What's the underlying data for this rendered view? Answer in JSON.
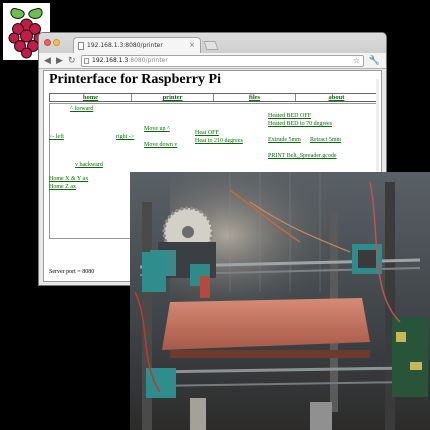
{
  "browser": {
    "tab_title": "192.168.1.3:8080/printer",
    "url_host": "192.168.1.3",
    "url_rest": ":8080/printer",
    "icons": [
      "back-arrow",
      "forward-arrow",
      "reload",
      "star",
      "wrench",
      "close"
    ]
  },
  "page": {
    "title": "Printerface for Raspberry Pi",
    "nav": [
      "home",
      "printer",
      "files",
      "about"
    ],
    "controls": {
      "forward": "^ forward",
      "left": "<- left",
      "right": "right ->",
      "backward": "v backward",
      "move_up": "Move up ^",
      "move_down": "Move down v",
      "heat_off": "Heat OFF",
      "heat_210": "Heat to 210 degrees",
      "heated_bed_off": "Heated BED OFF",
      "heated_bed_70": "Heated BED to 70 degrees",
      "extrude": "Extrude 5mm",
      "retract": "Retract 5mm",
      "print_belt": "PRINT Belt_Spreader.gcode",
      "home_xy": "Home X & Y ax",
      "home_z": "Home Z ax"
    },
    "server_port": "Server port = 8080"
  },
  "colors": {
    "link": "#096a09",
    "raspberry_red": "#c51a4a",
    "leaf_green": "#6cc04a"
  }
}
